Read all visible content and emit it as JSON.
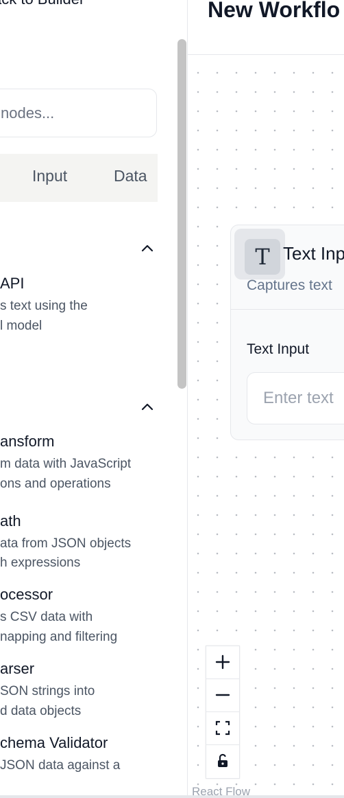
{
  "sidebar": {
    "back_label": "ack to Builder",
    "search_placeholder": "nodes...",
    "tabs": [
      "Input",
      "Data"
    ],
    "sections": [
      {
        "chevron": "chevron-up-icon",
        "items": [
          {
            "title": "API",
            "desc": [
              "s text using the",
              "l model"
            ]
          }
        ]
      },
      {
        "chevron": "chevron-up-icon",
        "items": [
          {
            "title": "ansform",
            "desc": [
              "m data with JavaScript",
              "ons and operations"
            ]
          },
          {
            "title": "ath",
            "desc": [
              "ata from JSON objects",
              "h expressions"
            ]
          },
          {
            "title": "ocessor",
            "desc": [
              "s CSV data with",
              "napping and filtering"
            ]
          },
          {
            "title": "arser",
            "desc": [
              "SON strings into",
              "d data objects"
            ]
          },
          {
            "title": "chema Validator",
            "desc": [
              " JSON data against a"
            ]
          }
        ]
      }
    ]
  },
  "header": {
    "title": "New Workflo"
  },
  "canvas": {
    "node": {
      "icon": "text-type-icon",
      "icon_glyph": "T",
      "name": "Text Inp",
      "subtitle": "Captures text",
      "field_label": "Text Input",
      "field_placeholder": "Enter text"
    },
    "controls": [
      "zoom-in-icon",
      "zoom-out-icon",
      "fit-view-icon",
      "lock-icon"
    ],
    "attribution": "React Flow"
  },
  "colors": {
    "dot_grid": "#b9bdc3",
    "tab_bg": "#f4f4f2",
    "scrollbar": "#c4c4c4"
  }
}
